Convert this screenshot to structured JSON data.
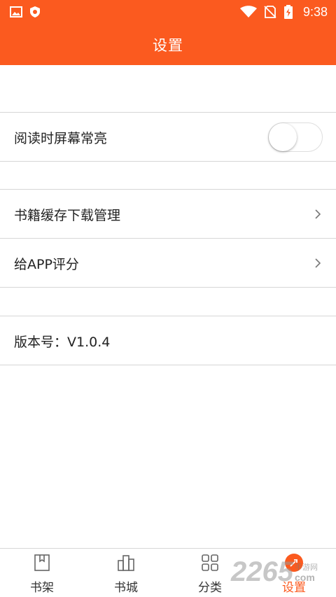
{
  "status_bar": {
    "time": "9:38",
    "left_icons": [
      "image-icon",
      "shield-icon"
    ],
    "right_icons": [
      "wifi-icon",
      "no-sim-icon",
      "battery-charging-icon"
    ]
  },
  "header": {
    "title": "设置",
    "background": "#fb5a1f"
  },
  "settings": {
    "keep_screen_on": {
      "label": "阅读时屏幕常亮",
      "enabled": false
    },
    "cache_manage": {
      "label": "书籍缓存下载管理"
    },
    "rate_app": {
      "label": "给APP评分"
    },
    "version": {
      "label": "版本号：V1.0.4"
    }
  },
  "bottom_nav": {
    "items": [
      {
        "label": "书架",
        "icon": "bookmark-icon"
      },
      {
        "label": "书城",
        "icon": "store-icon"
      },
      {
        "label": "分类",
        "icon": "category-grid-icon"
      },
      {
        "label": "设置",
        "icon": "settings-icon",
        "active": true
      }
    ],
    "active_color": "#fb5a1f"
  },
  "watermark": {
    "number": "2265",
    "text": "手游网",
    "domain": "com"
  }
}
